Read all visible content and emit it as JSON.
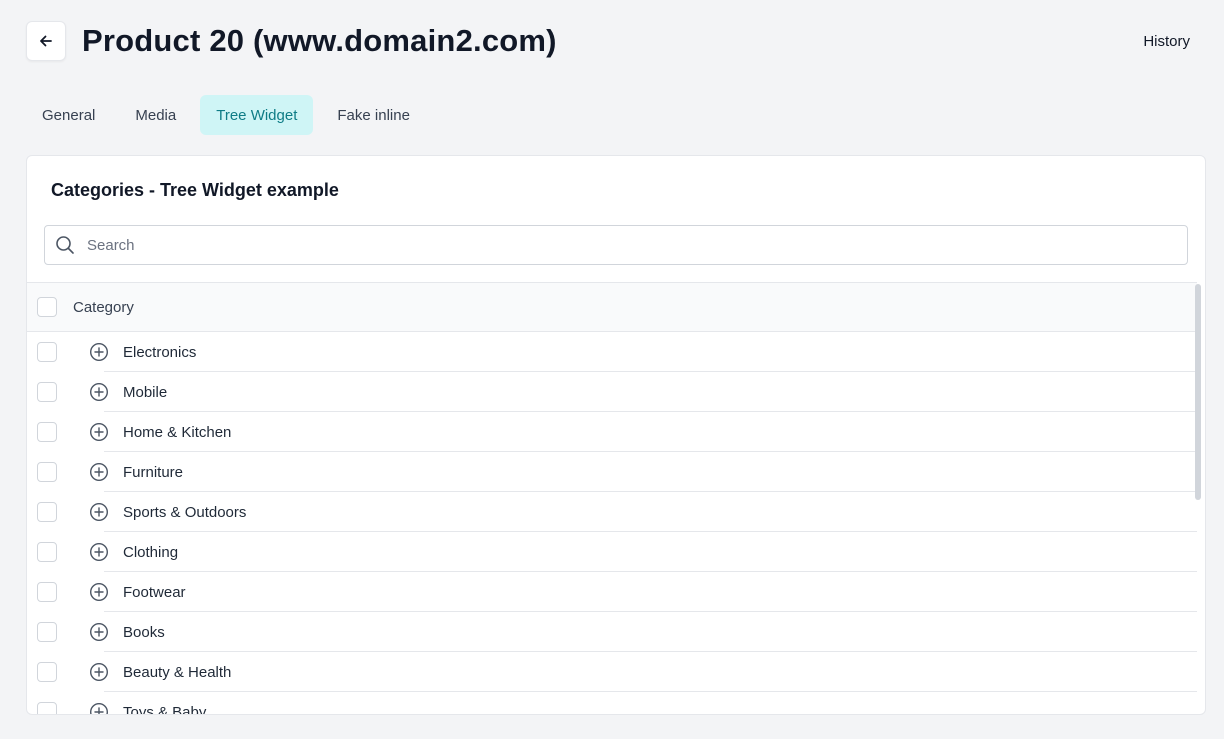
{
  "header": {
    "title": "Product 20 (www.domain2.com)",
    "history_label": "History"
  },
  "tabs": [
    {
      "label": "General"
    },
    {
      "label": "Media"
    },
    {
      "label": "Tree Widget"
    },
    {
      "label": "Fake inline"
    }
  ],
  "active_tab": "Tree Widget",
  "colors": {
    "accent": "#0e7c86",
    "active_tab_bg": "#cff5f6"
  },
  "card": {
    "title": "Categories - Tree Widget example"
  },
  "search": {
    "placeholder": "Search",
    "value": ""
  },
  "table": {
    "header": "Category",
    "rows": [
      {
        "label": "Electronics"
      },
      {
        "label": "Mobile"
      },
      {
        "label": "Home & Kitchen"
      },
      {
        "label": "Furniture"
      },
      {
        "label": "Sports & Outdoors"
      },
      {
        "label": "Clothing"
      },
      {
        "label": "Footwear"
      },
      {
        "label": "Books"
      },
      {
        "label": "Beauty & Health"
      },
      {
        "label": "Toys & Baby"
      }
    ]
  },
  "icons": {
    "back": "arrow-left-icon",
    "search": "search-icon",
    "expand": "plus-circle-icon"
  }
}
